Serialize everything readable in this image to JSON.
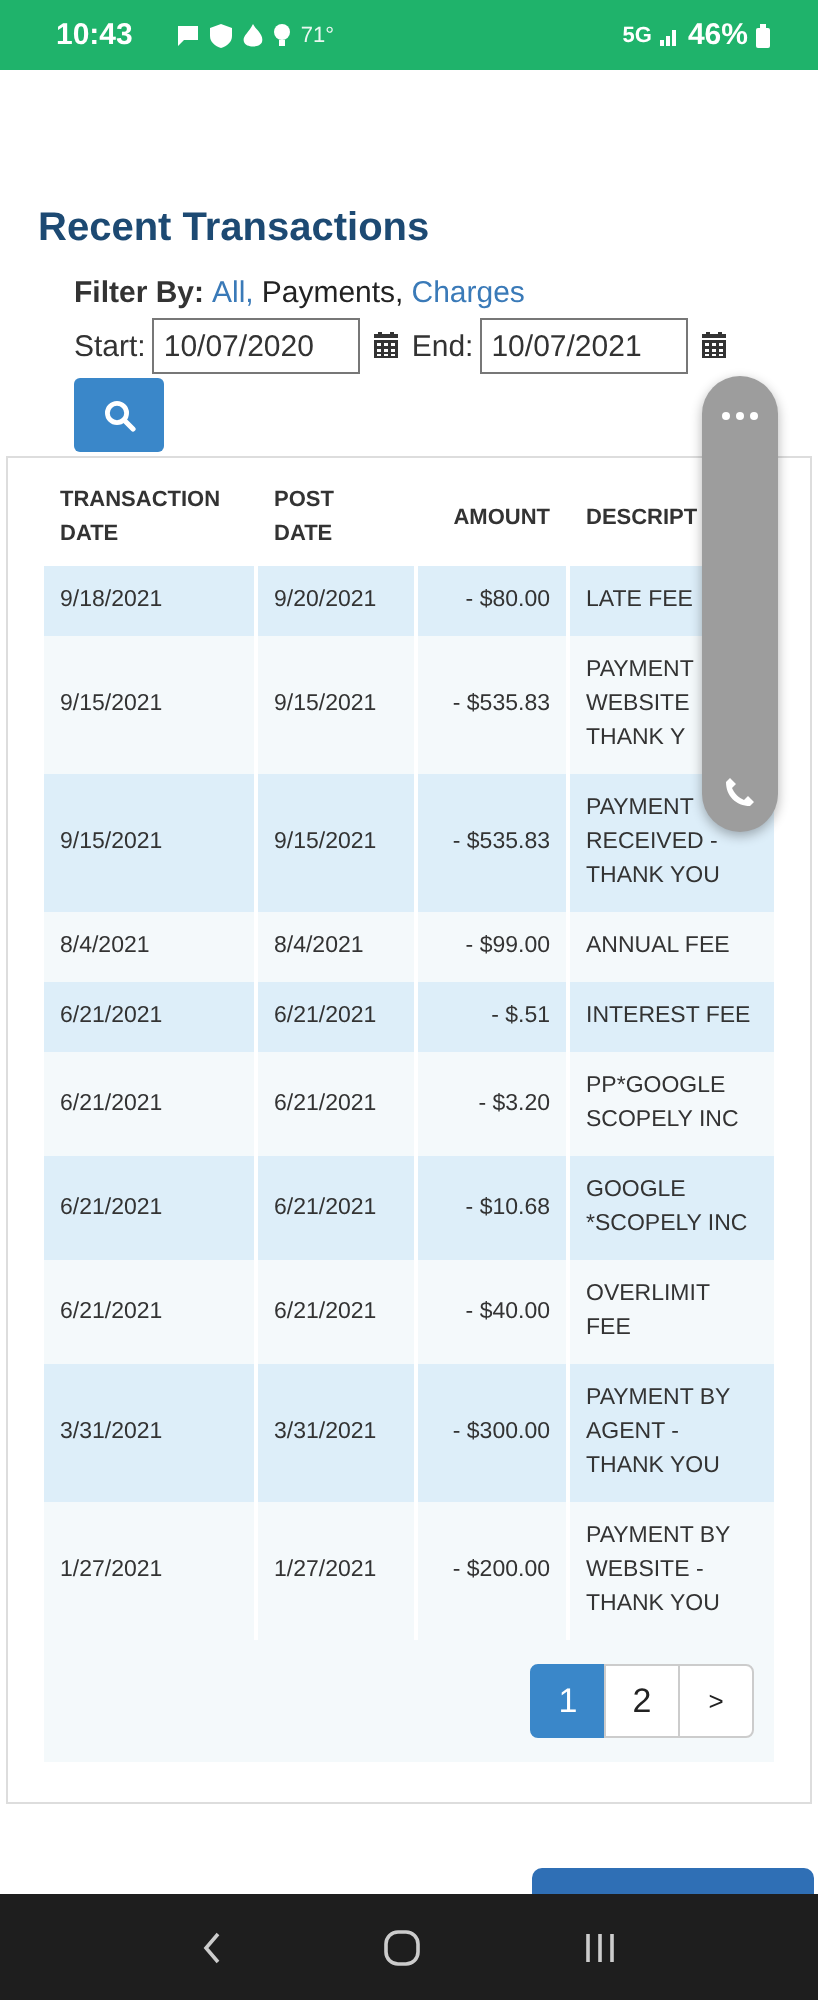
{
  "status_bar": {
    "time": "10:43",
    "temperature": "71°",
    "network": "5G",
    "battery": "46%"
  },
  "title": "Recent Transactions",
  "filter": {
    "label": "Filter By:",
    "options": [
      {
        "label": "All,",
        "selected": false
      },
      {
        "label": "Payments,",
        "selected": true
      },
      {
        "label": "Charges",
        "selected": false
      }
    ]
  },
  "date_range": {
    "start_label": "Start:",
    "start_value": "10/07/2020",
    "end_label": "End:",
    "end_value": "10/07/2021"
  },
  "table": {
    "columns": [
      "TRANSACTION DATE",
      "POST DATE",
      "AMOUNT",
      "DESCRIPT"
    ],
    "rows": [
      [
        "9/18/2021",
        "9/20/2021",
        "- $80.00",
        "LATE FEE"
      ],
      [
        "9/15/2021",
        "9/15/2021",
        "- $535.83",
        "PAYMENT\nWEBSITE\nTHANK Y"
      ],
      [
        "9/15/2021",
        "9/15/2021",
        "- $535.83",
        "PAYMENT\nRECEIVED -\nTHANK YOU"
      ],
      [
        "8/4/2021",
        "8/4/2021",
        "- $99.00",
        "ANNUAL FEE"
      ],
      [
        "6/21/2021",
        "6/21/2021",
        "- $.51",
        "INTEREST FEE"
      ],
      [
        "6/21/2021",
        "6/21/2021",
        "- $3.20",
        "PP*GOOGLE\nSCOPELY INC"
      ],
      [
        "6/21/2021",
        "6/21/2021",
        "- $10.68",
        "GOOGLE\n*SCOPELY INC"
      ],
      [
        "6/21/2021",
        "6/21/2021",
        "- $40.00",
        "OVERLIMIT\nFEE"
      ],
      [
        "3/31/2021",
        "3/31/2021",
        "- $300.00",
        "PAYMENT BY\nAGENT -\nTHANK YOU"
      ],
      [
        "1/27/2021",
        "1/27/2021",
        "- $200.00",
        "PAYMENT BY\nWEBSITE -\nTHANK YOU"
      ]
    ]
  },
  "pagination": [
    {
      "label": "1",
      "selected": true
    },
    {
      "label": "2",
      "selected": false
    },
    {
      "label": ">",
      "selected": false
    }
  ]
}
